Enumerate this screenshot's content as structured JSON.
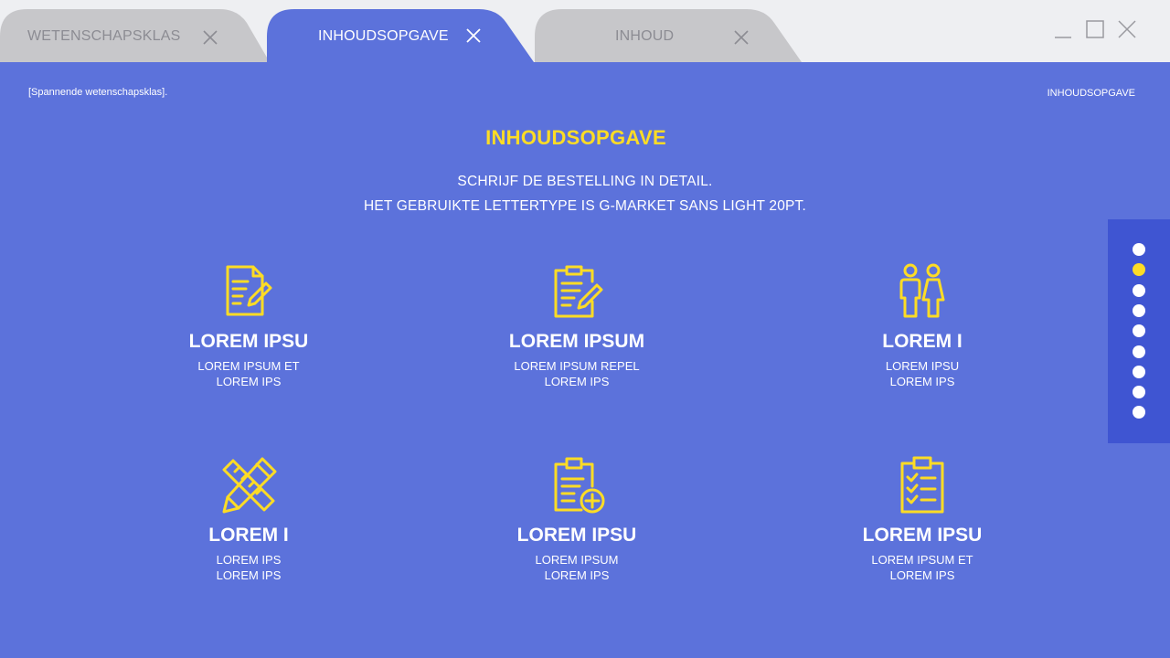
{
  "tabs": [
    {
      "label": "WETENSCHAPSKLAS",
      "active": false
    },
    {
      "label": "INHOUDSOPGAVE",
      "active": true
    },
    {
      "label": "INHOUD",
      "active": false
    }
  ],
  "window_controls": [
    "minimize-icon",
    "maximize-icon",
    "close-icon"
  ],
  "header": {
    "breadcrumb": "[Spannende wetenschapsklas].",
    "section": "INHOUDSOPGAVE"
  },
  "main": {
    "title": "INHOUDSOPGAVE",
    "subtitle_line1": "SCHRIJF DE BESTELLING IN DETAIL.",
    "subtitle_line2": "HET GEBRUIKTE LETTERTYPE IS G-MARKET SANS LIGHT 20PT.",
    "items": [
      {
        "icon": "document-edit-icon",
        "title": "LOREM IPSU",
        "desc1": "LOREM IPSUM ET",
        "desc2": "LOREM IPS"
      },
      {
        "icon": "clipboard-edit-icon",
        "title": "LOREM IPSUM",
        "desc1": "LOREM IPSUM REPEL",
        "desc2": "LOREM IPS"
      },
      {
        "icon": "people-icon",
        "title": "LOREM I",
        "desc1": "LOREM IPSU",
        "desc2": "LOREM IPS"
      },
      {
        "icon": "pencil-ruler-icon",
        "title": "LOREM I",
        "desc1": "LOREM IPS",
        "desc2": "LOREM IPS"
      },
      {
        "icon": "clipboard-add-icon",
        "title": "LOREM IPSU",
        "desc1": "LOREM IPSUM",
        "desc2": "LOREM IPS"
      },
      {
        "icon": "checklist-icon",
        "title": "LOREM IPSU",
        "desc1": "LOREM IPSUM ET",
        "desc2": "LOREM IPS"
      }
    ]
  },
  "pagination": {
    "total": 9,
    "active_index": 1
  },
  "colors": {
    "background": "#5c72db",
    "accent": "#fddc25",
    "titlebar": "#eeeff2",
    "inactive_tab": "#c7c7ca",
    "dot_panel": "#3f55d2"
  }
}
